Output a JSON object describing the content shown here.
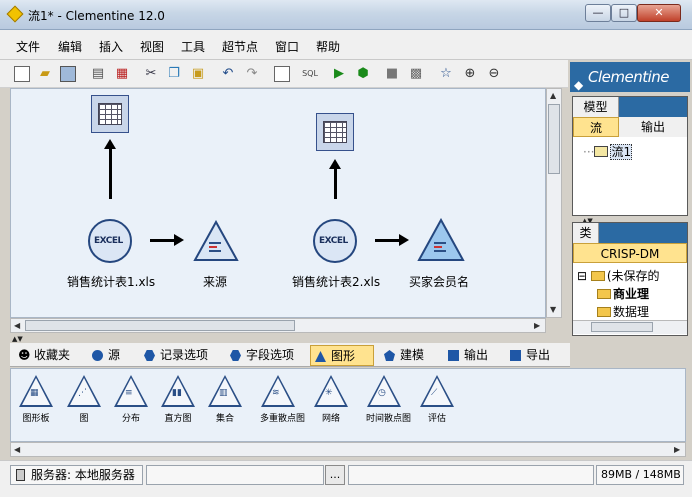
{
  "window": {
    "title": "流1* - Clementine 12.0",
    "min_symbol": "—",
    "max_symbol": "□",
    "close_symbol": "✕"
  },
  "menu": [
    "文件",
    "编辑",
    "插入",
    "视图",
    "工具",
    "超节点",
    "窗口",
    "帮助"
  ],
  "canvas": {
    "nodes": [
      {
        "label": "销售统计表1.xls",
        "type": "excel-source",
        "icon_text": "EXCEL"
      },
      {
        "label": "来源",
        "type": "type-node"
      },
      {
        "label": "销售统计表2.xls",
        "type": "excel-source",
        "icon_text": "EXCEL"
      },
      {
        "label": "买家会员名",
        "type": "type-node"
      }
    ]
  },
  "right_panel": {
    "logo": "Clementine",
    "top_tabs": [
      "模型",
      "流",
      "输出"
    ],
    "active_top_tab": "流",
    "stream_item": "流1",
    "project_tab": "类",
    "project_header": "CRISP-DM",
    "tree": [
      "(未保存的",
      "商业理",
      "数据理"
    ]
  },
  "palette_tabs": [
    {
      "label": "收藏夹",
      "icon": "favorites-icon"
    },
    {
      "label": "源",
      "icon": "circle-icon"
    },
    {
      "label": "记录选项",
      "icon": "hexagon-icon"
    },
    {
      "label": "字段选项",
      "icon": "hexagon-icon"
    },
    {
      "label": "图形",
      "icon": "triangle-icon",
      "active": true
    },
    {
      "label": "建模",
      "icon": "pentagon-icon"
    },
    {
      "label": "输出",
      "icon": "square-icon"
    },
    {
      "label": "导出",
      "icon": "square-icon"
    }
  ],
  "palette_items": [
    "图形板",
    "图",
    "分布",
    "直方图",
    "集合",
    "多重散点图",
    "网络",
    "时间散点图",
    "评估"
  ],
  "status": {
    "server": "服务器: 本地服务器",
    "more": "...",
    "memory": "89MB / 148MB"
  },
  "colors": {
    "active_tab": "#ffe38f",
    "node_blue": "#2b4f86",
    "logo_bg": "#2b6aa3"
  }
}
